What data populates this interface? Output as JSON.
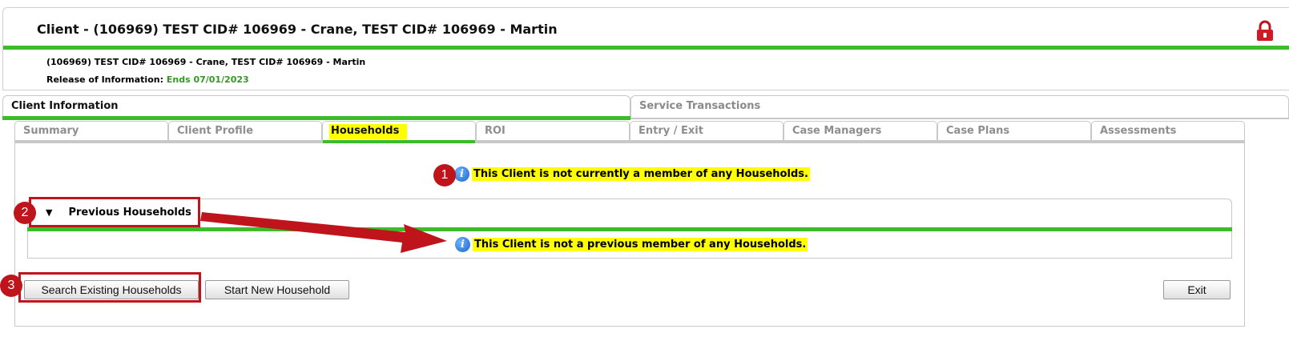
{
  "header": {
    "title": "Client - (106969) TEST CID# 106969 - Crane, TEST CID# 106969 - Martin",
    "client_line": "(106969) TEST CID# 106969 - Crane, TEST CID# 106969 - Martin",
    "roi_label": "Release of Information:",
    "roi_value": "Ends 07/01/2023",
    "lock_icon": "lock-icon"
  },
  "main_tabs": [
    {
      "label": "Client Information",
      "active": true
    },
    {
      "label": "Service Transactions",
      "active": false
    }
  ],
  "sub_tabs": [
    {
      "label": "Summary"
    },
    {
      "label": "Client Profile"
    },
    {
      "label": "Households",
      "active": true
    },
    {
      "label": "ROI"
    },
    {
      "label": "Entry / Exit"
    },
    {
      "label": "Case Managers"
    },
    {
      "label": "Case Plans"
    },
    {
      "label": "Assessments"
    }
  ],
  "households": {
    "current_message": "This Client is not currently a member of any Households.",
    "previous_section_label": "Previous Households",
    "previous_message": "This Client is not a previous member of any Households."
  },
  "buttons": {
    "search": "Search Existing Households",
    "start": "Start New Household",
    "exit": "Exit"
  },
  "annotations": [
    "1",
    "2",
    "3"
  ],
  "colors": {
    "accent_green": "#3dbb2a",
    "highlight_yellow": "#ffff00",
    "annotation_red": "#c0141c"
  }
}
